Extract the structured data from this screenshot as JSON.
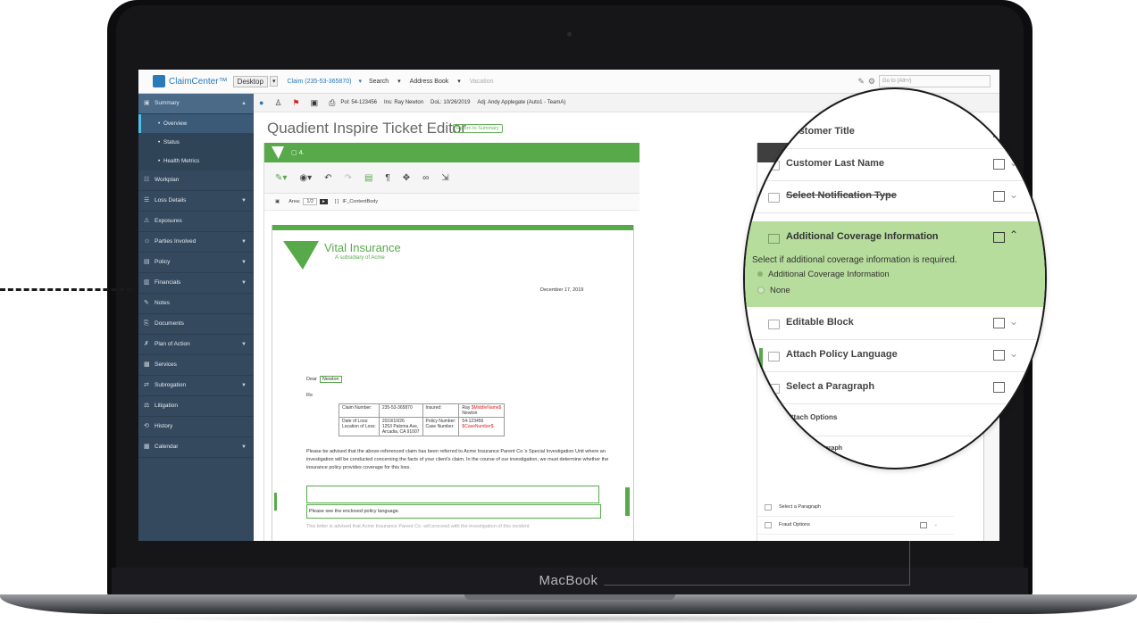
{
  "device": {
    "brand_label": "MacBook"
  },
  "app": {
    "logo_text": "ClaimCenter™",
    "desktop_label": "Desktop",
    "claim_tab": "Claim (235-53-365870)",
    "search_tab": "Search",
    "address_book_tab": "Address Book",
    "vacation_tab": "Vacation",
    "goto_placeholder": "Go to (Alt+/)"
  },
  "claim_info": {
    "pol": "Pol: 54-123456",
    "ins": "Ins: Ray Newton",
    "dol": "DoL: 10/26/2019",
    "adj": "Adj: Andy Applegate (Auto1 - TeamA)"
  },
  "sidebar": {
    "items": [
      {
        "label": "Summary",
        "icon": "summary-icon",
        "expanded": true
      },
      {
        "label": "Overview"
      },
      {
        "label": "Status"
      },
      {
        "label": "Health Metrics"
      },
      {
        "label": "Workplan"
      },
      {
        "label": "Loss Details"
      },
      {
        "label": "Exposures"
      },
      {
        "label": "Parties Involved"
      },
      {
        "label": "Policy"
      },
      {
        "label": "Financials"
      },
      {
        "label": "Notes"
      },
      {
        "label": "Documents"
      },
      {
        "label": "Plan of Action"
      },
      {
        "label": "Services"
      },
      {
        "label": "Subrogation"
      },
      {
        "label": "Litigation"
      },
      {
        "label": "History"
      },
      {
        "label": "Calendar"
      }
    ]
  },
  "page": {
    "title": "Quadient Inspire Ticket Editor",
    "return_button": "Return to Summary"
  },
  "editor": {
    "header_label": "4.",
    "area_label": "Area:",
    "area_value": "1/2",
    "content_label": "IF_ContentBody"
  },
  "document": {
    "company": "Vital Insurance",
    "subsidiary": "A subsidiary of Acme",
    "date": "December 17, 2019",
    "dear": "Dear",
    "dear_name": "Newton",
    "re": "Re",
    "claim_number_label": "Claim Number:",
    "claim_number": "235-53-365870",
    "insured_label": "Insured:",
    "insured_value_prefix": "Ray ",
    "insured_middle": "$MiddleName$",
    "insured_last": "Newton",
    "date_of_loss_label": "Date of Loss:",
    "date_of_loss": "2019/10/26",
    "policy_number_label": "Policy Number:",
    "policy_number": "54-123456",
    "location_label": "Location of Loss:",
    "location_1": "1253 Paloma Ave,",
    "location_2": "Arcadia, CA 91007",
    "case_number_label": "Case Number:",
    "case_number": "$CaseNumber$",
    "paragraph": "Please be advised that the above-referenced claim has been referred to Acme Insurance Parent Co.'s Special Investigation Unit where an investigation will be conducted concerning the facts of your client's claim. In the course of our investigation, we must determine whether the insurance policy provides coverage for this loss.",
    "policy_language": "Please see the enclosed policy language.",
    "cut_line": "This letter is advised that Acme Insurance Parent Co. will proceed with the investigation of this incident"
  },
  "right_panel": {
    "small_items": [
      "Select a Paragraph",
      "Fraud Options",
      "Attach Options"
    ]
  },
  "magnifier": {
    "rows": [
      {
        "label": "Customer Title"
      },
      {
        "label": "Customer Last Name"
      },
      {
        "label": "Select Notification Type"
      },
      {
        "label": "Additional Coverage Information"
      },
      {
        "label": "Editable Block"
      },
      {
        "label": "Attach Policy Language"
      },
      {
        "label": "Select a Paragraph"
      },
      {
        "label": "Attach Options"
      },
      {
        "label": "Select a Paragraph"
      }
    ],
    "description": "Select if additional coverage information is required.",
    "option_1": "Additional Coverage Information",
    "option_2": "None"
  }
}
